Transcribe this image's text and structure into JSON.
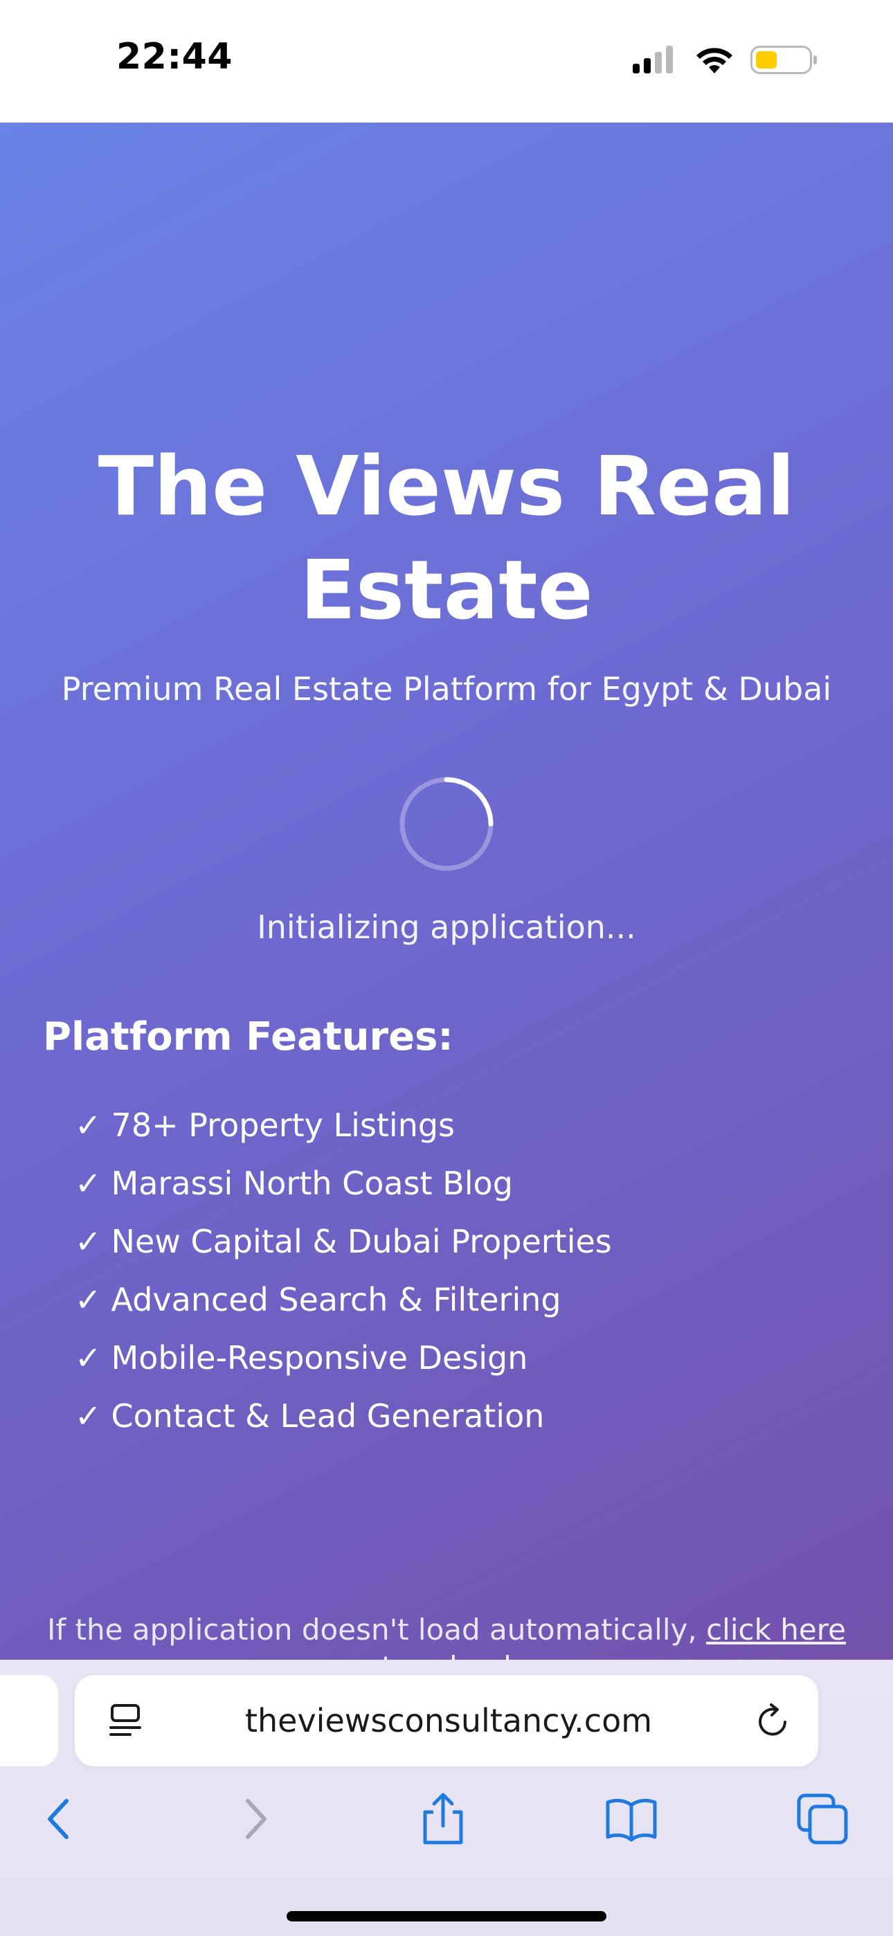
{
  "status_bar": {
    "time": "22:44",
    "icons": [
      "cellular-signal-icon",
      "wifi-icon",
      "battery-icon"
    ],
    "battery_color": "#ffcc00"
  },
  "page": {
    "title_line1": "The Views Real",
    "title_line2": "Estate",
    "subtitle": "Premium Real Estate Platform for Egypt & Dubai",
    "loading_text": "Initializing application...",
    "features_heading": "Platform Features:",
    "check_mark": "✓",
    "features": [
      "78+ Property Listings",
      "Marassi North Coast Blog",
      "New Capital & Dubai Properties",
      "Advanced Search & Filtering",
      "Mobile-Responsive Design",
      "Contact & Lead Generation"
    ],
    "reload_note_prefix": "If the application doesn't load automatically,",
    "reload_link": "click here to reload",
    "gradient_colors": [
      "#6a83e6",
      "#7352ad"
    ]
  },
  "browser": {
    "url": "theviewsconsultancy.com",
    "accent_color": "#1f7ae0",
    "toolbar_icons": [
      "back-icon",
      "forward-icon",
      "share-icon",
      "bookmarks-icon",
      "tabs-icon"
    ]
  }
}
